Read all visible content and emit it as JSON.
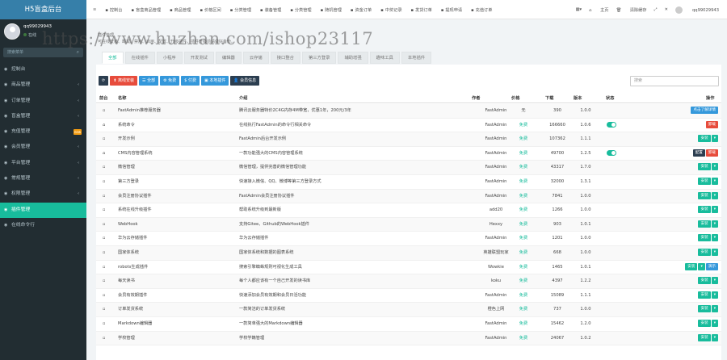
{
  "app": {
    "title": "H5盲盒后台"
  },
  "user": {
    "name": "qq99029943",
    "status": "在线",
    "top_name": "qq99029943"
  },
  "sidebar": {
    "search_placeholder": "搜索菜单",
    "items": [
      {
        "label": "控制台",
        "arrow": ""
      },
      {
        "label": "商品管理",
        "arrow": "‹"
      },
      {
        "label": "订单管理",
        "arrow": "‹"
      },
      {
        "label": "盲盒管理",
        "arrow": "‹"
      },
      {
        "label": "充值管理",
        "arrow": "‹",
        "badge": "new"
      },
      {
        "label": "会员管理",
        "arrow": "‹"
      },
      {
        "label": "平台管理",
        "arrow": "‹"
      },
      {
        "label": "常规管理",
        "arrow": "‹"
      },
      {
        "label": "权限管理",
        "arrow": "‹"
      },
      {
        "label": "插件管理",
        "arrow": "",
        "active": true
      },
      {
        "label": "在线命令行",
        "arrow": ""
      }
    ]
  },
  "topnav": [
    "控制台",
    "盲盒商品管理",
    "商品管理",
    "价格区间",
    "分类管理",
    "装备管理",
    "分类管理",
    "随机管理",
    "资金订单",
    "中奖记录",
    "发货订单",
    "提现申请",
    "充值订单"
  ],
  "topright": {
    "home": "主页",
    "clear": "清除缓存"
  },
  "page": {
    "title": "插件管理",
    "subtitle": "可在线安装、卸载、禁用、启用、配置、升级插件，插件升级前请做好备份。"
  },
  "tabs": [
    "全部",
    "在线插件",
    "小程序",
    "开发测试",
    "编辑器",
    "云存储",
    "接口整合",
    "第三方登录",
    "辅助增强",
    "趣味工具",
    "本地插件"
  ],
  "toolbar": {
    "refresh": "",
    "offline_install": "离线安装",
    "all": "全部",
    "free": "免费",
    "paid": "付费",
    "installed": "本地插件",
    "member": "会员信息"
  },
  "search_placeholder": "搜索",
  "columns": {
    "preview": "前台",
    "name": "名称",
    "intro": "介绍",
    "author": "作者",
    "price": "价格",
    "downloads": "下载",
    "version": "版本",
    "status": "状态",
    "operate": "操作"
  },
  "rows": [
    {
      "name": "FastAdmin推荐服务器",
      "intro": "腾讯云服务器特价2C4G内存4M带宽，优惠1年，200元/3年",
      "author": "FastAdmin",
      "price": "无",
      "downloads": "390",
      "version": "1.0.0",
      "status": "",
      "actions": [
        "点击了解详情"
      ]
    },
    {
      "name": "系统命令",
      "intro": "在线执行FastAdmin的命令行相关命令",
      "author": "FastAdmin",
      "price": "免费",
      "downloads": "166660",
      "version": "1.0.6",
      "status": "on",
      "actions": [
        "卸载"
      ]
    },
    {
      "name": "开发示例",
      "intro": "FastAdmin后台开发示例",
      "author": "FastAdmin",
      "price": "免费",
      "downloads": "107362",
      "version": "1.1.1",
      "status": "",
      "actions": [
        "安装"
      ]
    },
    {
      "name": "CMS内容管理系统",
      "intro": "一款功能强大的CMS内容管理系统",
      "author": "FastAdmin",
      "price": "免费",
      "downloads": "49700",
      "version": "1.2.5",
      "status": "on",
      "actions": [
        "配置",
        "卸载"
      ]
    },
    {
      "name": "微信管理",
      "intro": "微信管理，提供完善的微信管理功能",
      "author": "FastAdmin",
      "price": "免费",
      "downloads": "43317",
      "version": "1.7.0",
      "status": "",
      "actions": [
        "安装"
      ]
    },
    {
      "name": "第三方登录",
      "intro": "快速接入微信、QQ、微博等第三方登录方式",
      "author": "FastAdmin",
      "price": "免费",
      "downloads": "32000",
      "version": "1.3.1",
      "status": "",
      "actions": [
        "安装"
      ]
    },
    {
      "name": "会员注册协议插件",
      "intro": "FastAdmin会员注册协议插件",
      "author": "FastAdmin",
      "price": "免费",
      "downloads": "7841",
      "version": "1.0.0",
      "status": "",
      "actions": [
        "安装"
      ]
    },
    {
      "name": "系统在线升级插件",
      "intro": "帮助系统升级到最新版",
      "author": "add20",
      "price": "免费",
      "downloads": "1266",
      "version": "1.0.0",
      "status": "",
      "actions": [
        "安装"
      ]
    },
    {
      "name": "WebHook",
      "intro": "支持Gitee、Github的WebHook插件",
      "author": "Hexxy",
      "price": "免费",
      "downloads": "903",
      "version": "1.0.1",
      "status": "",
      "actions": [
        "安装"
      ]
    },
    {
      "name": "华为云存储插件",
      "intro": "华为云存储插件",
      "author": "FastAdmin",
      "price": "免费",
      "downloads": "1201",
      "version": "1.0.0",
      "status": "",
      "actions": [
        "安装"
      ]
    },
    {
      "name": "国家体系统",
      "intro": "国家体系统和数据的图表系统",
      "author": "英雄联盟玩家",
      "price": "免费",
      "downloads": "668",
      "version": "1.0.0",
      "status": "",
      "actions": [
        "安装"
      ]
    },
    {
      "name": "robots生成插件",
      "intro": "搜索引擎蜘蛛规则可视化生成工具",
      "author": "Wowkie",
      "price": "免费",
      "downloads": "1465",
      "version": "1.0.1",
      "status": "",
      "actions": [
        "安装",
        "演示"
      ]
    },
    {
      "name": "每天读书",
      "intro": "每个人都应该有一个自己开发的读书库",
      "author": "koku",
      "price": "免费",
      "downloads": "4397",
      "version": "1.2.2",
      "status": "",
      "actions": [
        "安装"
      ]
    },
    {
      "name": "会员有效期插件",
      "intro": "快速添加会员有效期和会员日活功能",
      "author": "FastAdmin",
      "price": "免费",
      "downloads": "15089",
      "version": "1.1.1",
      "status": "",
      "actions": [
        "安装"
      ]
    },
    {
      "name": "订单发货系统",
      "intro": "一款简洁的订单发货系统",
      "author": "橙色上网",
      "price": "免费",
      "downloads": "737",
      "version": "1.0.0",
      "status": "",
      "actions": [
        "安装"
      ]
    },
    {
      "name": "Markdown编辑器",
      "intro": "一款简单强大的Markdown编辑器",
      "author": "FastAdmin",
      "price": "免费",
      "downloads": "15462",
      "version": "1.2.0",
      "status": "",
      "actions": [
        "安装"
      ]
    },
    {
      "name": "学校管理",
      "intro": "学校学籍管理",
      "author": "FastAdmin",
      "price": "免费",
      "downloads": "24067",
      "version": "1.0.2",
      "status": "",
      "actions": [
        "安装"
      ]
    }
  ],
  "watermark": "https://www.huzhan.com/ishop23117"
}
